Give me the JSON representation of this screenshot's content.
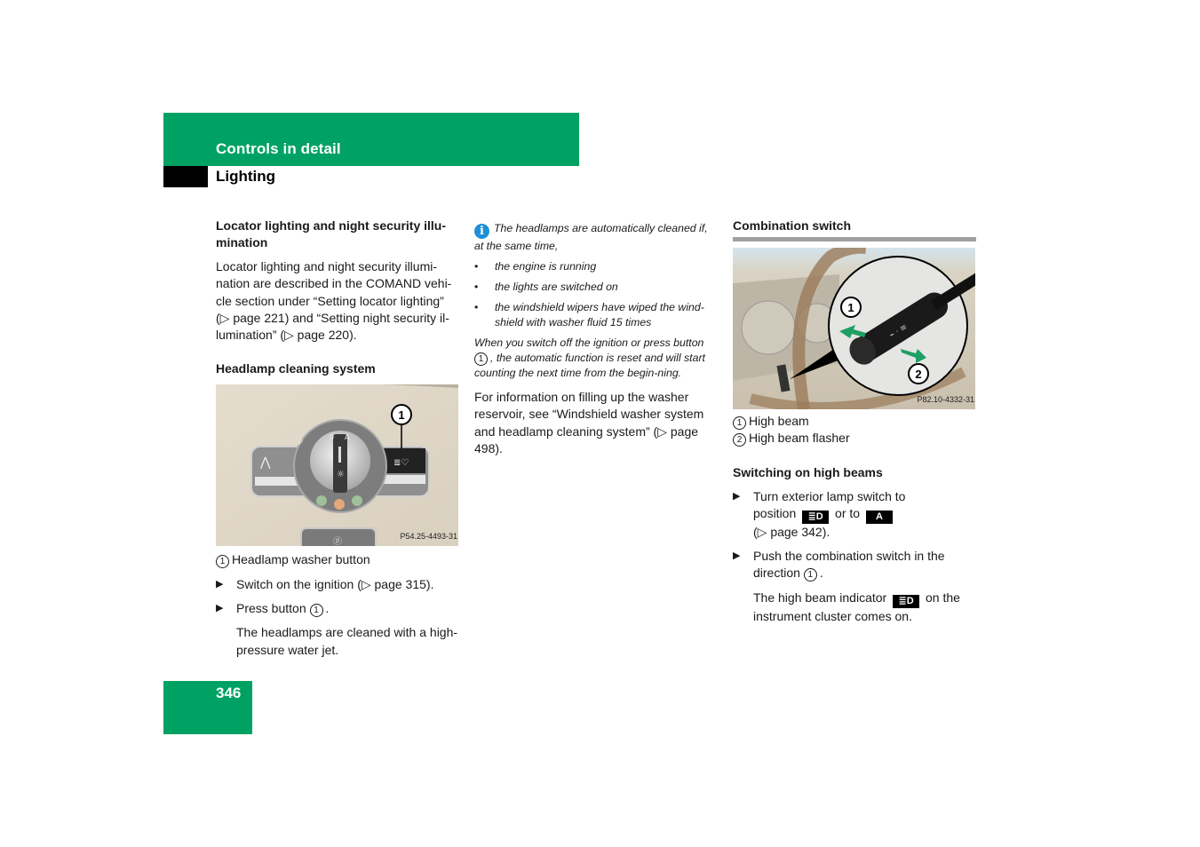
{
  "header": {
    "section": "Controls in detail",
    "subsection": "Lighting"
  },
  "page_number": "346",
  "col1": {
    "locator_heading": "Locator lighting and night security illu-mination",
    "locator_text": "Locator lighting and night security illumi-nation are described in the COMAND vehi-cle section under “Setting locator lighting” (▷ page 221) and “Setting night security il-lumination” (▷ page 220).",
    "cleaning_heading": "Headlamp cleaning system",
    "figure": {
      "callout": "1",
      "code": "P54.25-4493-31",
      "labels": [
        "P",
        "0",
        "A"
      ]
    },
    "legend": [
      {
        "num": "1",
        "label": "Headlamp washer button"
      }
    ],
    "steps": [
      {
        "text": "Switch on the ignition (▷ page 315)."
      },
      {
        "text_before": "Press button",
        "num": "1",
        "text_after": "."
      }
    ],
    "result": "The headlamps are cleaned with a high-pressure water jet."
  },
  "col2": {
    "info_icon": "i",
    "note_intro": "The headlamps are automatically cleaned if, at the same time,",
    "note_bullets": [
      "the engine is running",
      "the lights are switched on",
      "the windshield wipers have wiped the wind-shield with washer fluid 15 times"
    ],
    "note_reset_before": "When you switch off the ignition or press button",
    "note_reset_num": "1",
    "note_reset_after": ", the automatic function is reset and will start counting the next time from the begin-ning.",
    "washer_info": "For information on filling up the washer reservoir, see “Windshield washer system and headlamp cleaning system” (▷ page 498)."
  },
  "col3": {
    "combo_heading": "Combination switch",
    "figure": {
      "callouts": [
        "1",
        "2"
      ],
      "code": "P82.10-4332-31"
    },
    "legend": [
      {
        "num": "1",
        "label": "High beam"
      },
      {
        "num": "2",
        "label": "High beam flasher"
      }
    ],
    "highbeam_heading": "Switching on high beams",
    "step1": {
      "line1": "Turn exterior lamp switch to",
      "pos_label": "position",
      "sym1": "≣D",
      "or_to": "or to",
      "sym2": "A",
      "ref": "(▷ page 342)."
    },
    "step2": {
      "text_before": "Push the combination switch in the direction",
      "num": "1",
      "text_after": "."
    },
    "result": {
      "before": "The high beam indicator",
      "sym": "≣D",
      "after": "on the instrument cluster comes on."
    }
  },
  "colors": {
    "brand_green": "#00a264",
    "info_blue": "#1e8fd8",
    "arrow_green": "#1ea064"
  }
}
